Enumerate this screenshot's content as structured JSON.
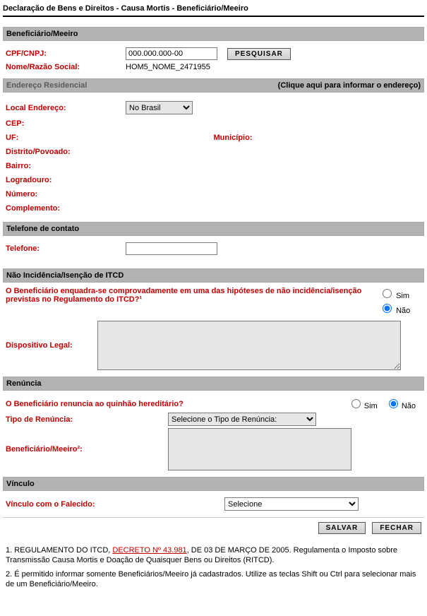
{
  "page_title": "Declaração de Bens e Direitos - Causa Mortis - Beneficiário/Meeiro",
  "beneficiario": {
    "header": "Beneficiário/Meeiro",
    "cpf_label": "CPF/CNPJ:",
    "cpf_value": "000.000.000-00",
    "pesquisar": "PESQUISAR",
    "nome_label": "Nome/Razão Social:",
    "nome_value": "HOM5_NOME_2471955"
  },
  "endereco": {
    "header": "Endereço Residencial",
    "header_right": "(Clique aqui para informar o endereço)",
    "local_label": "Local Endereço:",
    "local_value": "No Brasil",
    "cep_label": "CEP:",
    "uf_label": "UF:",
    "municipio_label": "Município:",
    "distrito_label": "Distrito/Povoado:",
    "bairro_label": "Bairro:",
    "logradouro_label": "Logradouro:",
    "numero_label": "Número:",
    "complemento_label": "Complemento:"
  },
  "telefone": {
    "header": "Telefone de contato",
    "label": "Telefone:",
    "value": ""
  },
  "itcd": {
    "header": "Não Incidência/Isenção de ITCD",
    "question": "O Beneficiário enquadra-se comprovadamente em uma das hipóteses de não incidência/isenção previstas no Regulamento do ITCD?¹",
    "sim": "Sim",
    "nao": "Não",
    "dispositivo_label": "Dispositivo Legal:",
    "dispositivo_value": ""
  },
  "renuncia": {
    "header": "Renúncia",
    "question": "O Beneficiário renuncia ao quinhão hereditário?",
    "sim": "Sim",
    "nao": "Não",
    "tipo_label": "Tipo de Renúncia:",
    "tipo_value": "Selecione o Tipo de Renúncia:",
    "benef_label": "Beneficiário/Meeiro²:"
  },
  "vinculo": {
    "header": "Vínculo",
    "label": "Vínculo com o Falecido:",
    "value": "Selecione"
  },
  "actions": {
    "salvar": "SALVAR",
    "fechar": "FECHAR"
  },
  "footnotes": {
    "n1a": "1. REGULAMENTO DO ITCD, ",
    "n1link": "DECRETO Nº 43.981",
    "n1b": ", DE 03 DE MARÇO DE 2005. Regulamenta o Imposto sobre Transmissão Causa Mortis e Doação de Quaisquer Bens ou Direitos (RITCD).",
    "n2": "2. É permitido informar somente Beneficiários/Meeiro já cadastrados. Utilize as teclas Shift ou Ctrl para selecionar mais de um Beneficiário/Meeiro."
  }
}
